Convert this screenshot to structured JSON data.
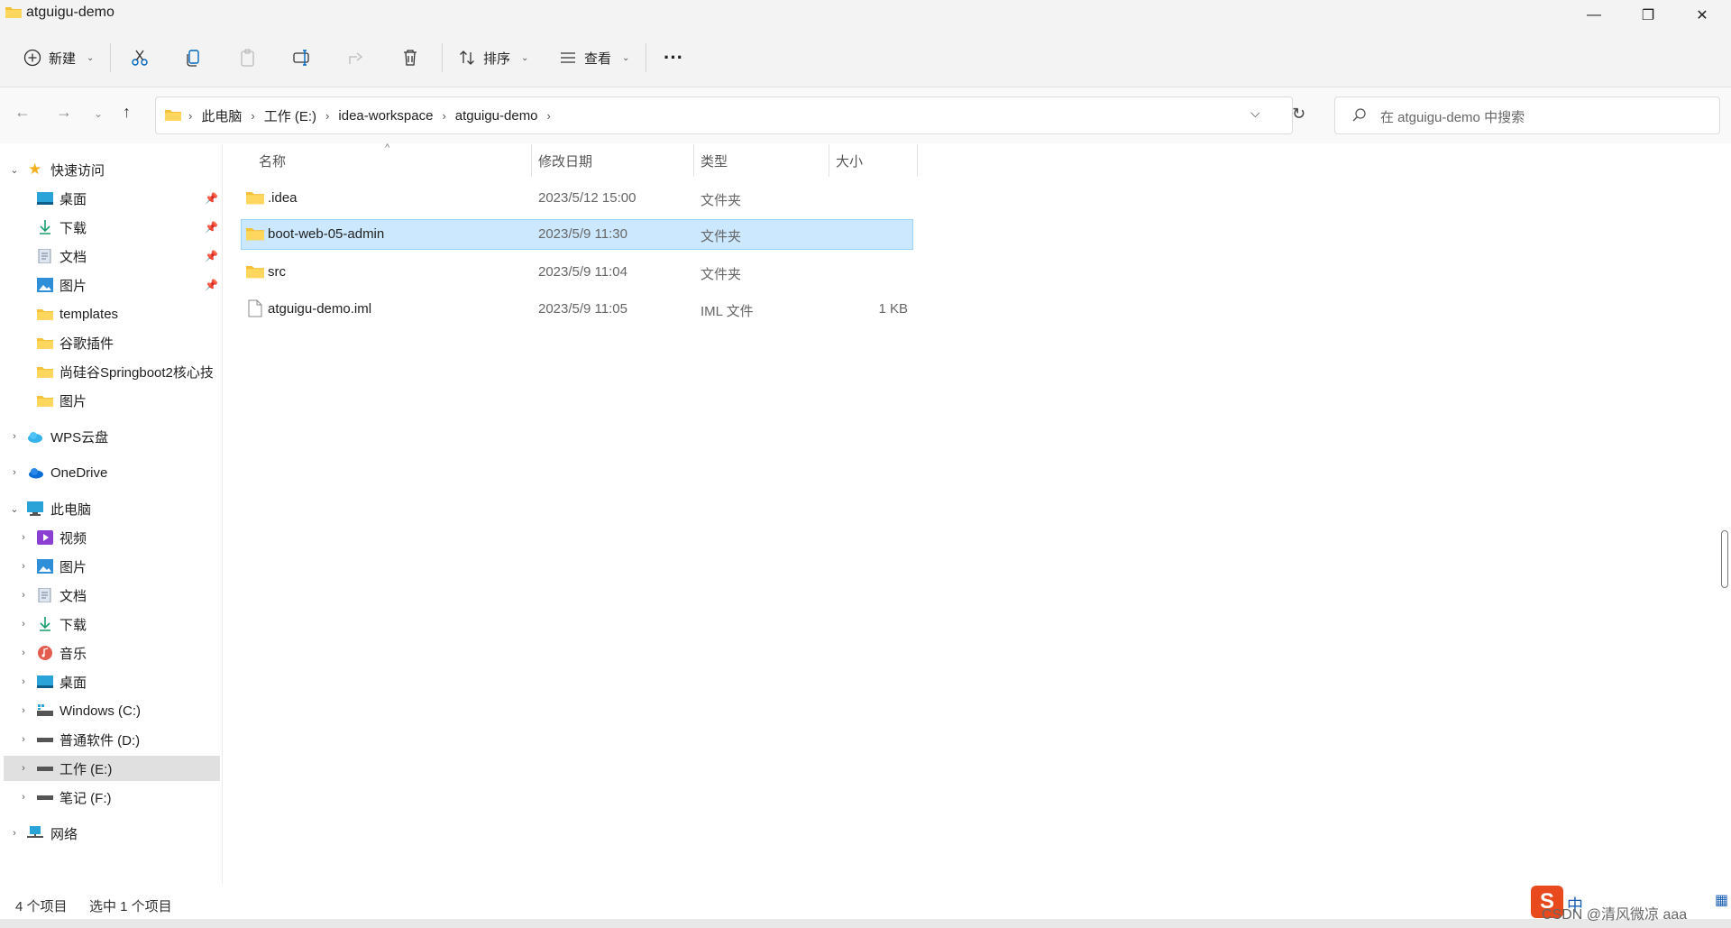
{
  "window": {
    "title": "atguigu-demo",
    "minimize_glyph": "—",
    "restore_glyph": "❐",
    "close_glyph": "✕"
  },
  "toolbar": {
    "new_label": "新建",
    "sort_label": "排序",
    "view_label": "查看",
    "more_glyph": "···"
  },
  "address": {
    "crumbs": [
      "此电脑",
      "工作 (E:)",
      "idea-workspace",
      "atguigu-demo"
    ],
    "crumb_sep": "›"
  },
  "search": {
    "placeholder": "在 atguigu-demo 中搜索"
  },
  "sidebar": {
    "quick_access": "快速访问",
    "quick_items": [
      "桌面",
      "下载",
      "文档",
      "图片",
      "templates",
      "谷歌插件",
      "尚硅谷Springboot2核心技",
      "图片"
    ],
    "wps": "WPS云盘",
    "onedrive": "OneDrive",
    "this_pc": "此电脑",
    "pc_items": [
      "视频",
      "图片",
      "文档",
      "下载",
      "音乐",
      "桌面",
      "Windows (C:)",
      "普通软件 (D:)",
      "工作 (E:)",
      "笔记 (F:)"
    ],
    "network": "网络"
  },
  "columns": {
    "name": "名称",
    "modified": "修改日期",
    "type": "类型",
    "size": "大小"
  },
  "files": [
    {
      "name": ".idea",
      "modified": "2023/5/12 15:00",
      "type": "文件夹",
      "size": ""
    },
    {
      "name": "boot-web-05-admin",
      "modified": "2023/5/9 11:30",
      "type": "文件夹",
      "size": ""
    },
    {
      "name": "src",
      "modified": "2023/5/9 11:04",
      "type": "文件夹",
      "size": ""
    },
    {
      "name": "atguigu-demo.iml",
      "modified": "2023/5/9 11:05",
      "type": "IML 文件",
      "size": "1 KB"
    }
  ],
  "status": {
    "count": "4 个项目",
    "selected": "选中 1 个项目"
  },
  "tray": {
    "ime": "中",
    "watermark": "CSDN @清风微凉 aaa"
  },
  "colors": {
    "selection": "#cce8ff",
    "folder": "#f4c13b",
    "accent": "#0067c0"
  }
}
